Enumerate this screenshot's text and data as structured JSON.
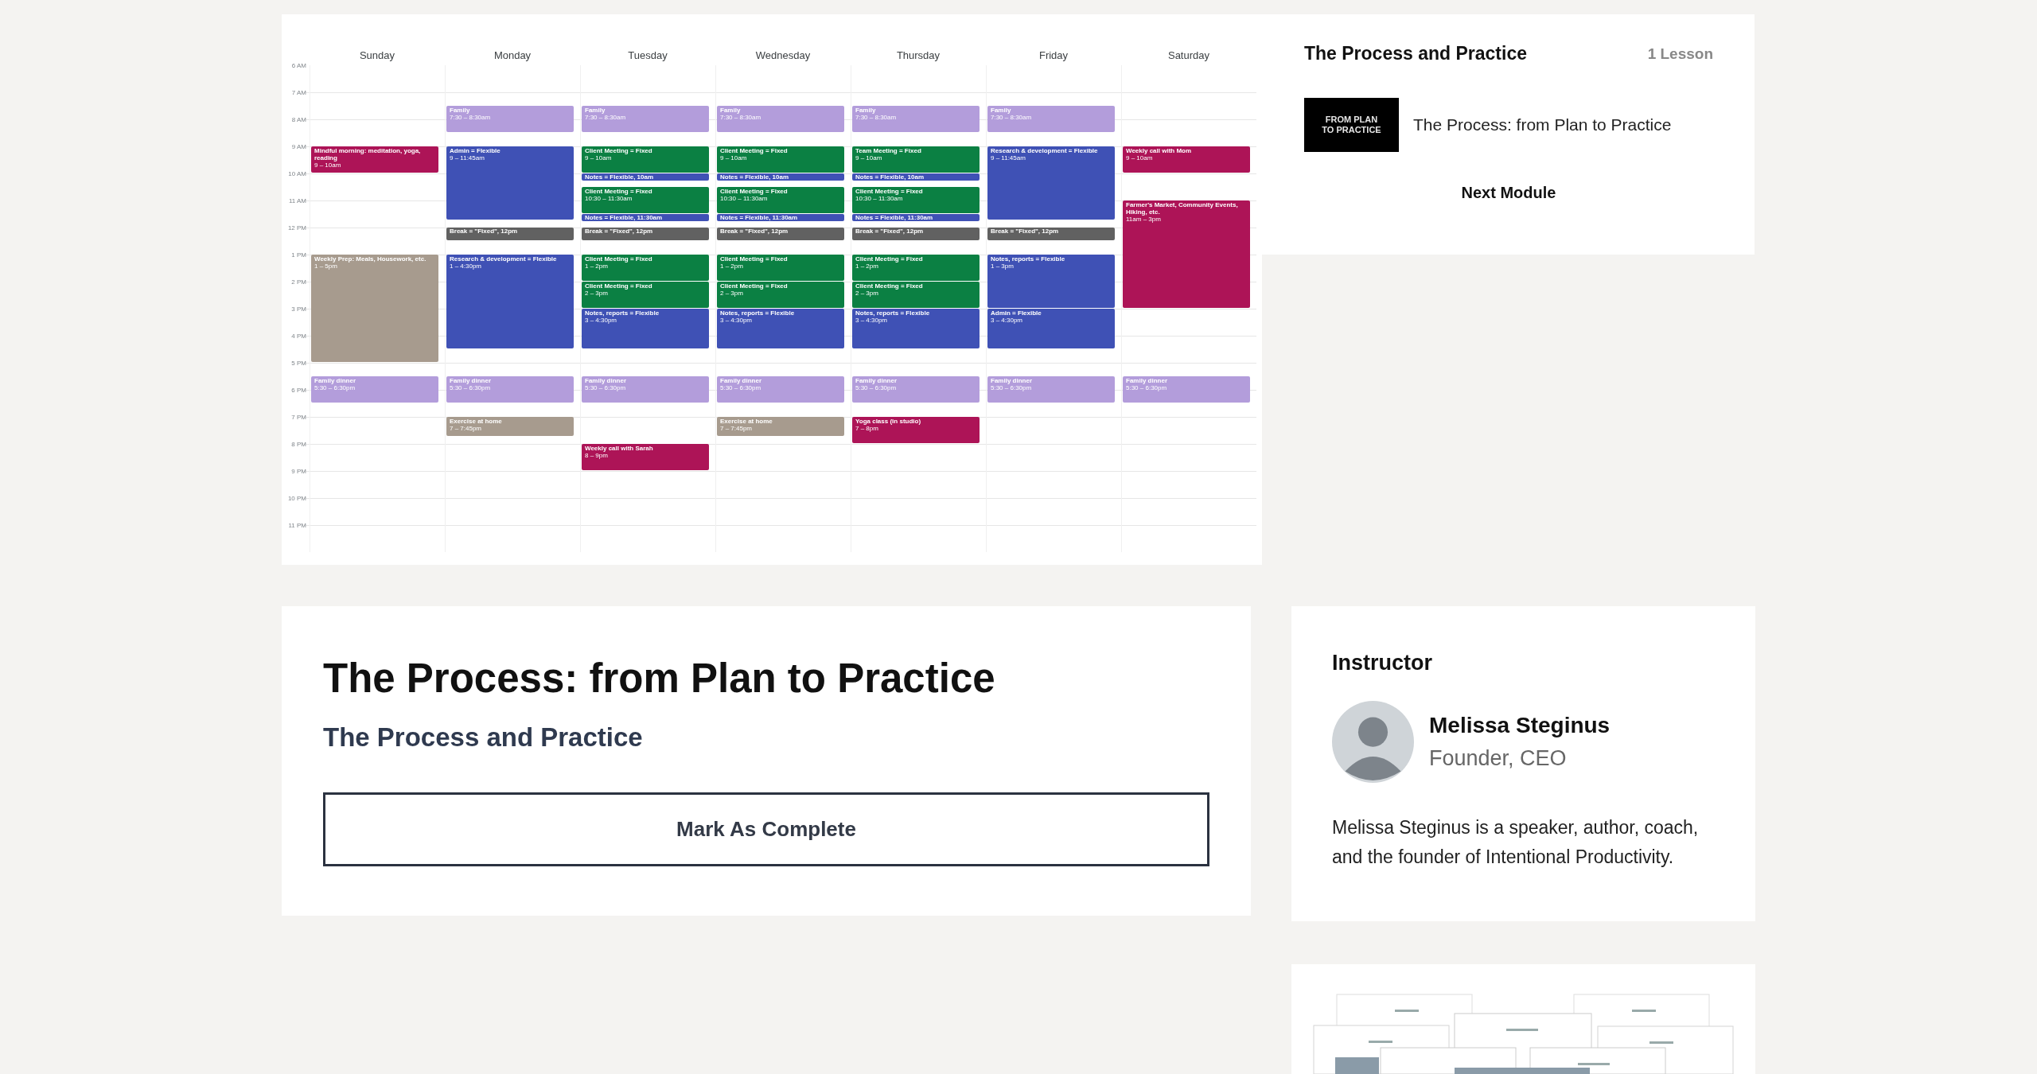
{
  "calendar": {
    "hours": [
      "6 AM",
      "7 AM",
      "8 AM",
      "9 AM",
      "10 AM",
      "11 AM",
      "12 PM",
      "1 PM",
      "2 PM",
      "3 PM",
      "4 PM",
      "5 PM",
      "6 PM",
      "7 PM",
      "8 PM",
      "9 PM",
      "10 PM",
      "11 PM"
    ],
    "days": [
      {
        "name": "Sunday",
        "events": [
          {
            "kind": "event",
            "title": "Mindful morning: meditation, yoga, reading",
            "time": "9 – 10am",
            "color": "#ad1457"
          },
          {
            "kind": "event",
            "title": "Weekly Prep: Meals, Housework, etc.",
            "time": "1 – 5pm",
            "color": "#a79b8e"
          },
          {
            "kind": "event",
            "title": "Family dinner",
            "time": "5:30 – 6:30pm",
            "color": "#b39ddb"
          }
        ]
      },
      {
        "name": "Monday",
        "events": [
          {
            "kind": "event",
            "title": "Family",
            "time": "7:30 – 8:30am",
            "color": "#b39ddb"
          },
          {
            "kind": "event",
            "title": "Admin = Flexible",
            "time": "9 – 11:45am",
            "color": "#3f51b5"
          },
          {
            "kind": "break",
            "title": "Break = \"Fixed\", 12pm",
            "color": "#616161"
          },
          {
            "kind": "event",
            "title": "Research & development = Flexible",
            "time": "1 – 4:30pm",
            "color": "#3f51b5"
          },
          {
            "kind": "event",
            "title": "Family dinner",
            "time": "5:30 – 6:30pm",
            "color": "#b39ddb"
          },
          {
            "kind": "event",
            "title": "Exercise at home",
            "time": "7 – 7:45pm",
            "color": "#a79b8e"
          }
        ]
      },
      {
        "name": "Tuesday",
        "events": [
          {
            "kind": "event",
            "title": "Family",
            "time": "7:30 – 8:30am",
            "color": "#b39ddb"
          },
          {
            "kind": "event",
            "title": "Client Meeting = Fixed",
            "time": "9 – 10am",
            "color": "#0b8043"
          },
          {
            "kind": "note",
            "title": "Notes = Flexible, 10am",
            "color": "#3f51b5"
          },
          {
            "kind": "event",
            "title": "Client Meeting = Fixed",
            "time": "10:30 – 11:30am",
            "color": "#0b8043"
          },
          {
            "kind": "note",
            "title": "Notes = Flexible, 11:30am",
            "color": "#3f51b5"
          },
          {
            "kind": "break",
            "title": "Break = \"Fixed\", 12pm",
            "color": "#616161"
          },
          {
            "kind": "event",
            "title": "Client Meeting = Fixed",
            "time": "1 – 2pm",
            "color": "#0b8043"
          },
          {
            "kind": "event",
            "title": "Client Meeting = Fixed",
            "time": "2 – 3pm",
            "color": "#0b8043"
          },
          {
            "kind": "event",
            "title": "Notes, reports = Flexible",
            "time": "3 – 4:30pm",
            "color": "#3f51b5"
          },
          {
            "kind": "event",
            "title": "Family dinner",
            "time": "5:30 – 6:30pm",
            "color": "#b39ddb"
          },
          {
            "kind": "event",
            "title": "Weekly call with Sarah",
            "time": "8 – 9pm",
            "color": "#ad1457"
          }
        ]
      },
      {
        "name": "Wednesday",
        "events": [
          {
            "kind": "event",
            "title": "Family",
            "time": "7:30 – 8:30am",
            "color": "#b39ddb"
          },
          {
            "kind": "event",
            "title": "Client Meeting = Fixed",
            "time": "9 – 10am",
            "color": "#0b8043"
          },
          {
            "kind": "note",
            "title": "Notes = Flexible, 10am",
            "color": "#3f51b5"
          },
          {
            "kind": "event",
            "title": "Client Meeting = Fixed",
            "time": "10:30 – 11:30am",
            "color": "#0b8043"
          },
          {
            "kind": "note",
            "title": "Notes = Flexible, 11:30am",
            "color": "#3f51b5"
          },
          {
            "kind": "break",
            "title": "Break = \"Fixed\", 12pm",
            "color": "#616161"
          },
          {
            "kind": "event",
            "title": "Client Meeting = Fixed",
            "time": "1 – 2pm",
            "color": "#0b8043"
          },
          {
            "kind": "event",
            "title": "Client Meeting = Fixed",
            "time": "2 – 3pm",
            "color": "#0b8043"
          },
          {
            "kind": "event",
            "title": "Notes, reports = Flexible",
            "time": "3 – 4:30pm",
            "color": "#3f51b5"
          },
          {
            "kind": "event",
            "title": "Family dinner",
            "time": "5:30 – 6:30pm",
            "color": "#b39ddb"
          },
          {
            "kind": "event",
            "title": "Exercise at home",
            "time": "7 – 7:45pm",
            "color": "#a79b8e"
          }
        ]
      },
      {
        "name": "Thursday",
        "events": [
          {
            "kind": "event",
            "title": "Family",
            "time": "7:30 – 8:30am",
            "color": "#b39ddb"
          },
          {
            "kind": "event",
            "title": "Team Meeting = Fixed",
            "time": "9 – 10am",
            "color": "#0b8043"
          },
          {
            "kind": "note",
            "title": "Notes = Flexible, 10am",
            "color": "#3f51b5"
          },
          {
            "kind": "event",
            "title": "Client Meeting = Fixed",
            "time": "10:30 – 11:30am",
            "color": "#0b8043"
          },
          {
            "kind": "note",
            "title": "Notes = Flexible, 11:30am",
            "color": "#3f51b5"
          },
          {
            "kind": "break",
            "title": "Break = \"Fixed\", 12pm",
            "color": "#616161"
          },
          {
            "kind": "event",
            "title": "Client Meeting = Fixed",
            "time": "1 – 2pm",
            "color": "#0b8043"
          },
          {
            "kind": "event",
            "title": "Client Meeting = Fixed",
            "time": "2 – 3pm",
            "color": "#0b8043"
          },
          {
            "kind": "event",
            "title": "Notes, reports = Flexible",
            "time": "3 – 4:30pm",
            "color": "#3f51b5"
          },
          {
            "kind": "event",
            "title": "Family dinner",
            "time": "5:30 – 6:30pm",
            "color": "#b39ddb"
          },
          {
            "kind": "event",
            "title": "Yoga class (in studio)",
            "time": "7 – 8pm",
            "color": "#ad1457"
          }
        ]
      },
      {
        "name": "Friday",
        "events": [
          {
            "kind": "event",
            "title": "Family",
            "time": "7:30 – 8:30am",
            "color": "#b39ddb"
          },
          {
            "kind": "event",
            "title": "Research & development = Flexible",
            "time": "9 – 11:45am",
            "color": "#3f51b5"
          },
          {
            "kind": "break",
            "title": "Break = \"Fixed\", 12pm",
            "color": "#616161"
          },
          {
            "kind": "event",
            "title": "Notes, reports = Flexible",
            "time": "1 – 3pm",
            "color": "#3f51b5"
          },
          {
            "kind": "event",
            "title": "Admin = Flexible",
            "time": "3 – 4:30pm",
            "color": "#3f51b5"
          },
          {
            "kind": "event",
            "title": "Family dinner",
            "time": "5:30 – 6:30pm",
            "color": "#b39ddb"
          }
        ]
      },
      {
        "name": "Saturday",
        "events": [
          {
            "kind": "event",
            "title": "Weekly call with Mom",
            "time": "9 – 10am",
            "color": "#ad1457"
          },
          {
            "kind": "event",
            "title": "Farmer's Market, Community Events, Hiking, etc.",
            "time": "11am – 3pm",
            "color": "#ad1457"
          },
          {
            "kind": "event",
            "title": "Family dinner",
            "time": "5:30 – 6:30pm",
            "color": "#b39ddb"
          }
        ]
      }
    ]
  },
  "module": {
    "title": "The Process and Practice",
    "count": "1 Lesson",
    "lessons": [
      {
        "thumbnail_text": "FROM PLAN TO PRACTICE",
        "title": "The Process: from Plan to Practice"
      }
    ],
    "next": "Next Module"
  },
  "lesson": {
    "title": "The Process: from Plan to Practice",
    "module": "The Process and Practice",
    "button": "Mark As Complete"
  },
  "instructor": {
    "heading": "Instructor",
    "name": "Melissa Steginus",
    "role": "Founder, CEO",
    "bio": "Melissa Steginus is a speaker, author, coach, and the founder of Intentional Productivity."
  }
}
